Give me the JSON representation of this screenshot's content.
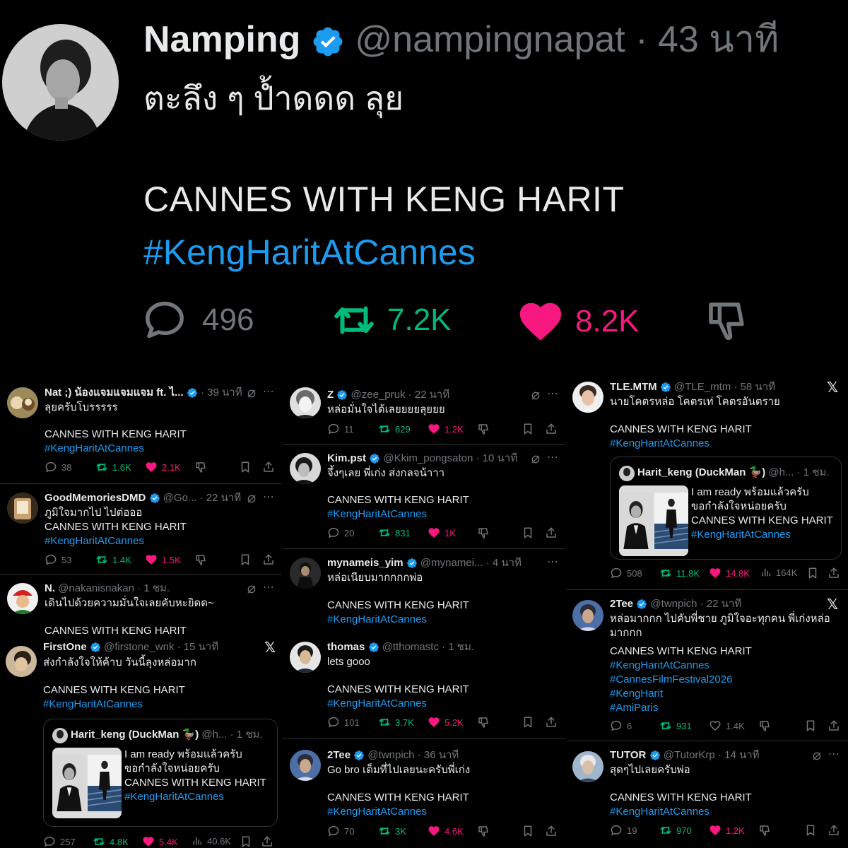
{
  "main": {
    "name": "Namping",
    "handle": "@nampingnapat",
    "sep": "·",
    "time": "43 นาที",
    "text": "ตะลึง ๆ ป้ำดดด ลุย",
    "body": "CANNES WITH KENG HARIT",
    "hashtag": "#KengHaritAtCannes",
    "replies": "496",
    "retweets": "7.2K",
    "likes": "8.2K"
  },
  "colors": {
    "bg": "#000000",
    "text": "#e7e9ea",
    "muted": "#71767b",
    "link": "#1d9bf0",
    "retweet": "#00ba7c",
    "like": "#f91880",
    "verified": "#1d9bf0"
  },
  "common": {
    "body": "CANNES WITH KENG HARIT",
    "hashtag": "#KengHaritAtCannes"
  },
  "quote": {
    "name": "Harit_keng (DuckMan 🦆)",
    "text1": "I am ready พร้อมแล้วครับ",
    "text2": "ขอกำลังใจหน่อยครับ",
    "body": "CANNES WITH KENG HARIT",
    "hashtag": "#KengHaritAtCannes"
  },
  "col1": [
    {
      "name": "Nat ;) น้องแจมแจมแจม ft. ไ...",
      "handle": "",
      "time": "· 39 นาที",
      "text": "ลุยครับโบรรรรร",
      "replies": "38",
      "retweets": "1.6K",
      "likes": "2.1K"
    },
    {
      "name": "GoodMemoriesDMD",
      "handle": "@Go...",
      "time": "· 22 นาที",
      "text": "ภูมิใจมากไป ไปต่อออ",
      "replies": "53",
      "retweets": "1.4K",
      "likes": "1.5K"
    },
    {
      "name": "N.",
      "handle": "@nakanisnakan",
      "time": "· 1 ชม.",
      "text": "เดินไปด้วยความมั่นใจเลยคับหะยิดด~"
    },
    {
      "name": "FirstOne",
      "handle": "@firstone_wnk",
      "time": "· 15 นาที",
      "text": "ส่งกำลังใจให้ค้าบ วันนี้ลุงหล่อมาก",
      "q_handle": "@h...",
      "q_time": "· 1 ชม.",
      "replies": "257",
      "retweets": "4.8K",
      "likes": "5.4K",
      "views": "40.6K"
    }
  ],
  "col2": [
    {
      "name": "Z",
      "handle": "@zee_pruk",
      "time": "· 22 นาที",
      "text": "หล่อมั่นใจได้เลยยยยลุยยย",
      "replies": "11",
      "retweets": "629",
      "likes": "1.2K"
    },
    {
      "name": "Kim.pst",
      "handle": "@Kkim_pongsaton",
      "time": "· 10 นาที",
      "text": "จึ้งๆเลย พี่เก่ง ส่งกลจน้าาา",
      "replies": "20",
      "retweets": "831",
      "likes": "1K"
    },
    {
      "name": "mynameis_yim",
      "handle": "@mynamei...",
      "time": "· 4 นาที",
      "text": "หล่อเนียบมากกกกพ่อ"
    },
    {
      "name": "thomas",
      "handle": "@tthomastc",
      "time": "· 1 ชม.",
      "text": "lets gooo",
      "replies": "101",
      "retweets": "3.7K",
      "likes": "5.2K"
    },
    {
      "name": "2Tee",
      "handle": "@twnpich",
      "time": "· 36 นาที",
      "text": "Go bro เต็มที่ไปเลยนะครับพี่เก่ง",
      "replies": "70",
      "retweets": "3K",
      "likes": "4.6K"
    }
  ],
  "col3": [
    {
      "name": "TLE.MTM",
      "handle": "@TLE_mtm",
      "time": "· 58 นาที",
      "text": "นายโคตรหล่อ โคตรเท่ โคตรอันตราย",
      "q_handle": "@h...",
      "q_time": "· 1 ชม.",
      "replies": "508",
      "retweets": "11.8K",
      "likes": "14.8K",
      "views": "164K"
    },
    {
      "name": "2Tee",
      "handle": "@twnpich",
      "time": "· 22 นาที",
      "text": "หล่อมากกก ไปคับพี่ชาย ภูมิใจอะทุกคน พี่เก่งหล่อ",
      "text2": "มากกก",
      "tags": [
        "#KengHaritAtCannes",
        "#CannesFilmFestival2026",
        "#KengHarit",
        "#AmiParis"
      ],
      "replies": "6",
      "retweets": "931",
      "likes": "1.4K"
    },
    {
      "name": "TUTOR",
      "handle": "@TutorKrp",
      "time": "· 14 นาที",
      "text": "สุดๆไปเลยครับพ่อ",
      "replies": "19",
      "retweets": "970",
      "likes": "1.2K"
    }
  ]
}
